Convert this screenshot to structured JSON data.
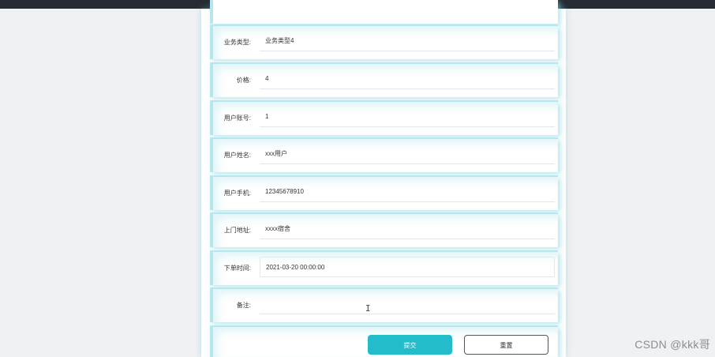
{
  "form": {
    "fields": [
      {
        "label": "业务类型:",
        "value": "业务类型4"
      },
      {
        "label": "价格:",
        "value": "4"
      },
      {
        "label": "用户账号:",
        "value": "1"
      },
      {
        "label": "用户姓名:",
        "value": "xxx用户"
      },
      {
        "label": "用户手机:",
        "value": "12345678910"
      },
      {
        "label": "上门地址:",
        "value": "xxxx宿舍"
      },
      {
        "label": "下单时间:",
        "value": "2021-03-20 00:00:00"
      },
      {
        "label": "备注:",
        "value": ""
      }
    ],
    "submit_label": "提交",
    "reset_label": "重置"
  },
  "colors": {
    "accent": "#22bccb",
    "topbar": "#262a33",
    "row_border": "#b7e7ee"
  },
  "cursor_glyph": "I",
  "watermark": "CSDN @kkk哥"
}
